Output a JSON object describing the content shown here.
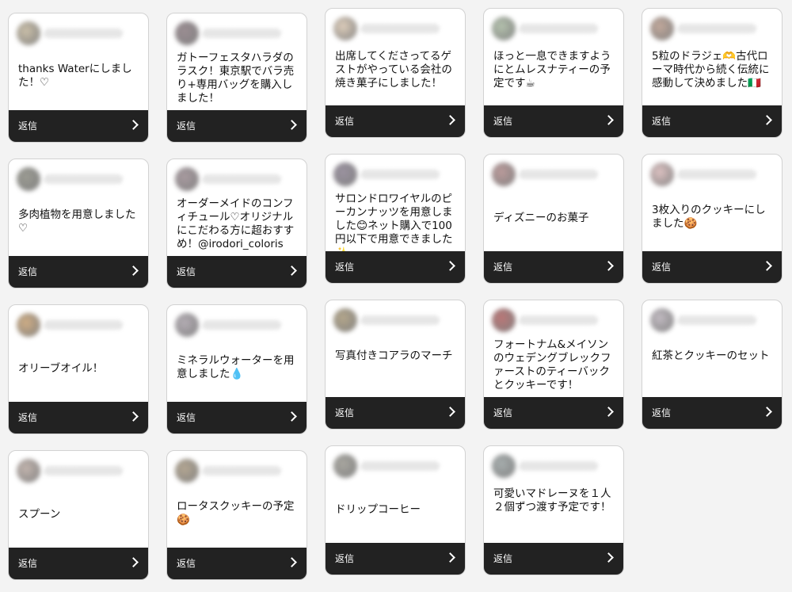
{
  "reply_label": "返信",
  "cards": [
    {
      "text": "thanks Waterにしました！♡",
      "avatar_color": "#c2b59a"
    },
    {
      "text": "ガトーフェスタハラダのラスク！東京駅でバラ売り+専用バッグを購入しました！",
      "avatar_color": "#8a7a80"
    },
    {
      "text": "出席してくださってるゲストがやっている会社の焼き菓子にしました！",
      "avatar_color": "#d9c6b0"
    },
    {
      "text": "ほっと一息できますようにとムレスナティーの予定です☕",
      "avatar_color": "#a8b8a0"
    },
    {
      "text": "5粒のドラジェ🫶古代ローマ時代から続く伝統に感動して決めました🇮🇹",
      "avatar_color": "#b89a8a"
    },
    {
      "text": "多肉植物を用意しました♡",
      "avatar_color": "#8a8a80"
    },
    {
      "text": "オーダーメイドのコンフィチュール♡オリジナルにこだわる方に超おすすめ！@irodori_coloris",
      "avatar_color": "#9a8a90"
    },
    {
      "text": "サロンドロワイヤルのピーカンナッツを用意しました😊ネット購入で100円以下で用意できました✨",
      "avatar_color": "#8a8090"
    },
    {
      "text": "ディズニーのお菓子",
      "avatar_color": "#b08a8a"
    },
    {
      "text": "3枚入りのクッキーにしました🍪",
      "avatar_color": "#d8b8b8"
    },
    {
      "text": "オリーブオイル！",
      "avatar_color": "#c8a070"
    },
    {
      "text": "ミネラルウォーターを用意しました💧",
      "avatar_color": "#a8a0a8"
    },
    {
      "text": "写真付きコアラのマーチ",
      "avatar_color": "#a89878"
    },
    {
      "text": "フォートナム&メイソンのウェデングブレックファーストのティーバックとクッキーです！",
      "avatar_color": "#b06060"
    },
    {
      "text": "紅茶とクッキーのセット",
      "avatar_color": "#b8b0b8"
    },
    {
      "text": "スプーン",
      "avatar_color": "#b8a8a0"
    },
    {
      "text": "ロータスクッキーの予定🍪",
      "avatar_color": "#a89880"
    },
    {
      "text": "ドリップコーヒー",
      "avatar_color": "#9a9890"
    },
    {
      "text": "可愛いマドレーヌを１人２個ずつ渡す予定です！",
      "avatar_color": "#98a0a0"
    }
  ]
}
